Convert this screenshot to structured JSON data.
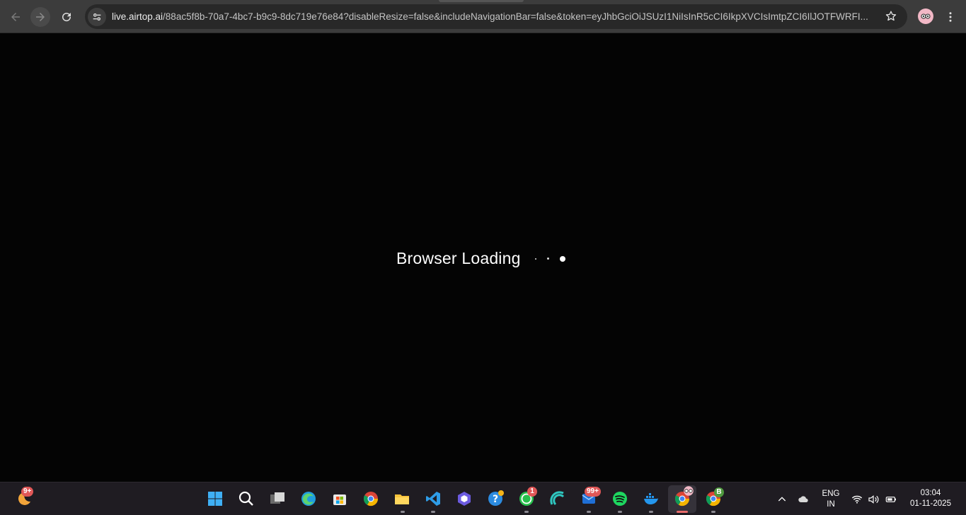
{
  "browser": {
    "url_host": "live.airtop.ai",
    "url_rest": "/88ac5f8b-70a7-4bc7-b9c9-8dc719e76e84?disableResize=false&includeNavigationBar=false&token=eyJhbGciOiJSUzI1NiIsInR5cCI6IkpXVCIsImtpZCI6IlJOTFWRFI..."
  },
  "page": {
    "loading_text": "Browser Loading"
  },
  "taskbar": {
    "weather_badge": "9+",
    "whatsapp_badge": "1",
    "mail_badge": "99+",
    "chrome2_badge": "B"
  },
  "tray": {
    "lang_line1": "ENG",
    "lang_line2": "IN",
    "time": "03:04",
    "date": "01-11-2025"
  },
  "colors": {
    "page_bg": "#040404",
    "chrome_bar": "#3c3c3c",
    "omnibox": "#282828",
    "taskbar": "#1f1c22",
    "badge_red": "#e05757",
    "badge_green": "#4f9a3e"
  }
}
